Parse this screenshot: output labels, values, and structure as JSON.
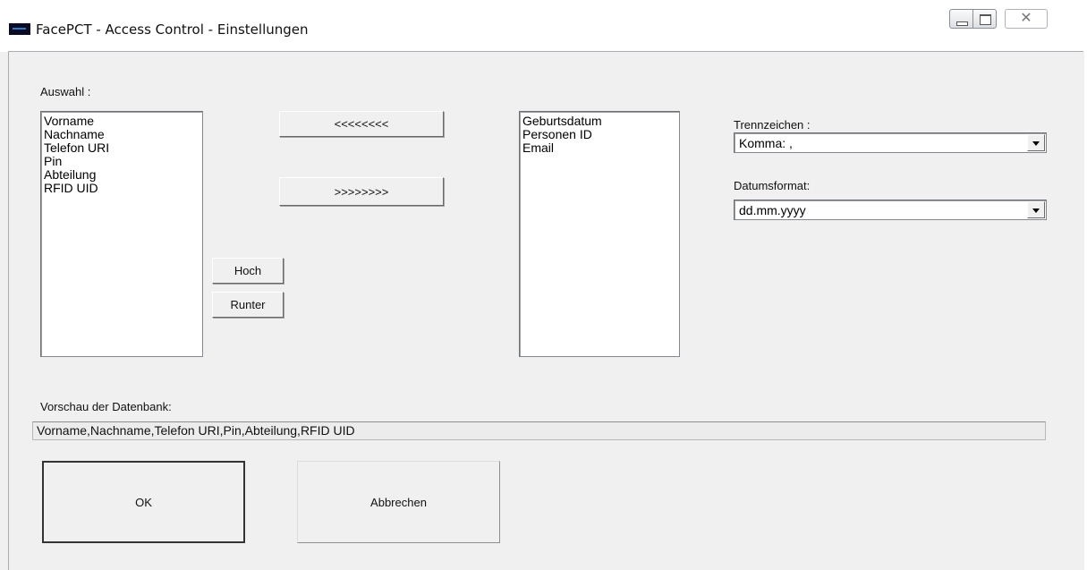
{
  "window": {
    "title": "FacePCT  - Access Control - Einstellungen",
    "close_glyph": "✕"
  },
  "auswahl": {
    "label": "Auswahl :",
    "items": [
      "Vorname",
      "Nachname",
      "Telefon URI",
      "Pin",
      "Abteilung",
      "RFID UID"
    ]
  },
  "buttons": {
    "move_left": "<<<<<<<<",
    "move_right": ">>>>>>>>",
    "up": "Hoch",
    "down": "Runter",
    "ok": "OK",
    "cancel": "Abbrechen"
  },
  "verfuegbar": {
    "items": [
      "Geburtsdatum",
      "Personen ID",
      "Email"
    ]
  },
  "trennzeichen": {
    "label": "Trennzeichen :",
    "value": "Komma: ,"
  },
  "datumsformat": {
    "label": "Datumsformat:",
    "value": "dd.mm.yyyy"
  },
  "vorschau": {
    "label": "Vorschau der Datenbank:",
    "value": "Vorname,Nachname,Telefon URI,Pin,Abteilung,RFID UID"
  }
}
